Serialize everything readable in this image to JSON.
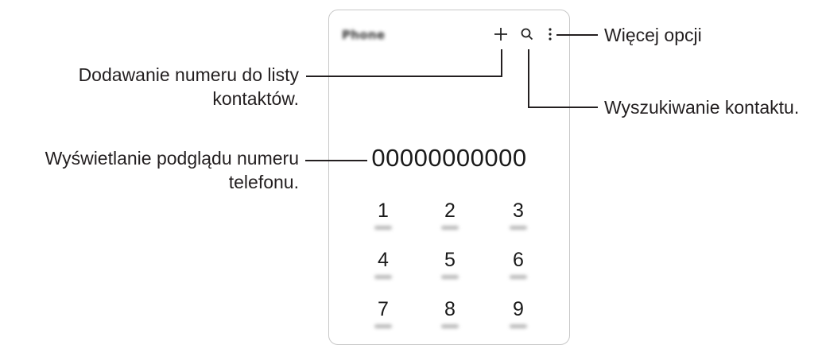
{
  "phone": {
    "app_title": "Phone",
    "number": "00000000000",
    "keys": [
      "1",
      "2",
      "3",
      "4",
      "5",
      "6",
      "7",
      "8",
      "9"
    ],
    "toolbar_icons": [
      "add-icon",
      "search-icon",
      "more-options-icon"
    ]
  },
  "callouts": {
    "more_options": "Więcej opcji",
    "add_contact_line1": "Dodawanie numeru do listy",
    "add_contact_line2": "kontaktów.",
    "search_contact": "Wyszukiwanie kontaktu.",
    "preview_line1": "Wyświetlanie podglądu numeru",
    "preview_line2": "telefonu."
  },
  "colors": {
    "text": "#231f20",
    "frame": "#c8c8c8",
    "leader_line": "#231f20"
  }
}
